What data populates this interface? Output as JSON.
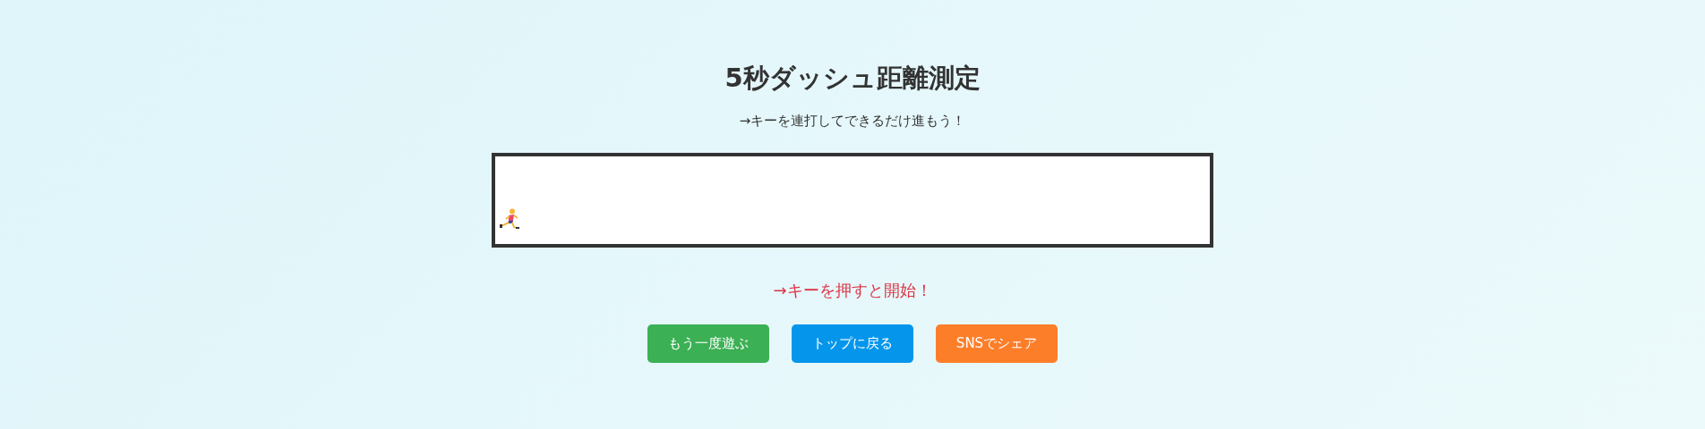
{
  "title": "5秒ダッシュ距離測定",
  "instruction": "→キーを連打してできるだけ進もう！",
  "track": {
    "runner": {
      "level": 0
    }
  },
  "status": "→キーを押すと開始！",
  "buttons": [
    {
      "label": "もう一度遊ぶ",
      "color": "#3cb054"
    },
    {
      "label": "トップに戻る",
      "color": "#0596ec"
    },
    {
      "label": "SNSでシェア",
      "color": "#fd7e29"
    }
  ]
}
